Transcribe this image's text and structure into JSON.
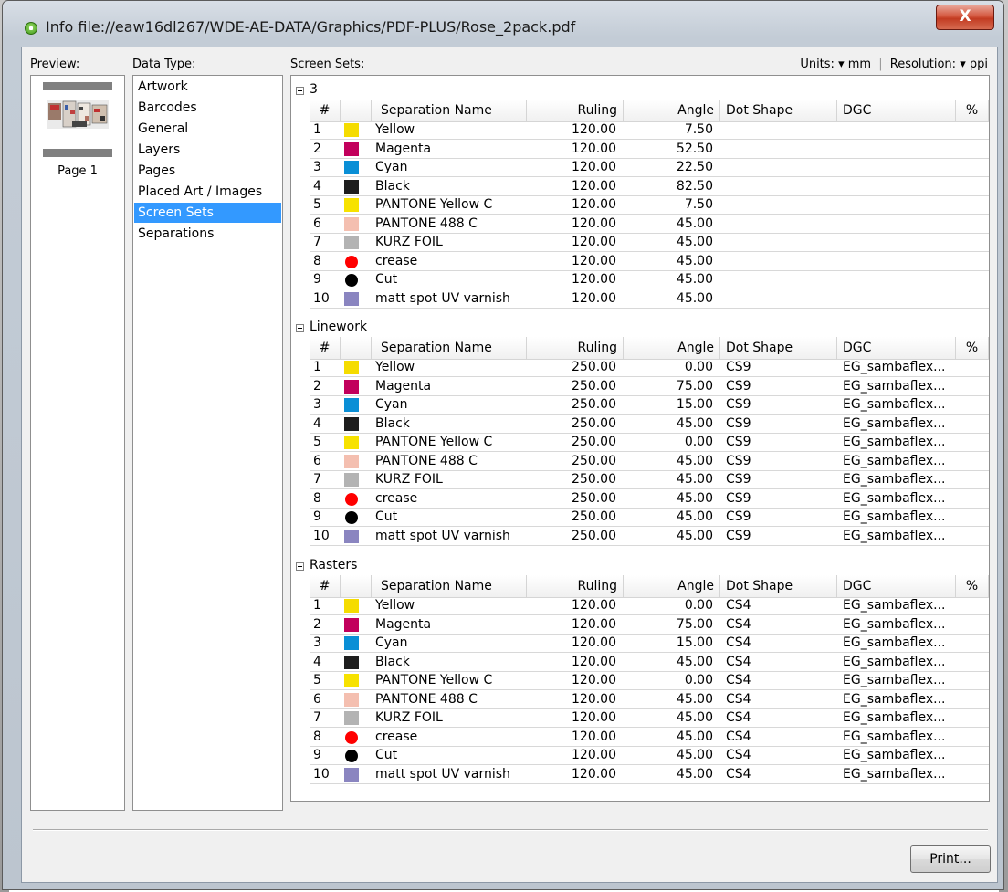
{
  "window": {
    "title": "Info file://eaw16dl267/WDE-AE-DATA/Graphics/PDF-PLUS/Rose_2pack.pdf",
    "close_label": "X"
  },
  "preview": {
    "label": "Preview:",
    "page_label": "Page 1"
  },
  "data_type": {
    "label": "Data Type:",
    "items": [
      "Artwork",
      "Barcodes",
      "General",
      "Layers",
      "Pages",
      "Placed Art / Images",
      "Screen Sets",
      "Separations"
    ],
    "selected": "Screen Sets"
  },
  "screen_sets": {
    "label": "Screen Sets:",
    "units_label": "Units:",
    "units_value": "mm",
    "resolution_label": "Resolution:",
    "resolution_value": "ppi",
    "columns": [
      "#",
      "",
      "Separation Name",
      "Ruling",
      "Angle",
      "Dot Shape",
      "DGC",
      "%"
    ],
    "groups": [
      {
        "name": "3",
        "rows": [
          {
            "num": "1",
            "color": "#f5dc00",
            "shape": "square",
            "name": "Yellow",
            "ruling": "120.00",
            "angle": "7.50",
            "dot": "",
            "dgc": ""
          },
          {
            "num": "2",
            "color": "#c2005c",
            "shape": "square",
            "name": "Magenta",
            "ruling": "120.00",
            "angle": "52.50",
            "dot": "",
            "dgc": ""
          },
          {
            "num": "3",
            "color": "#0a8fd6",
            "shape": "square",
            "name": "Cyan",
            "ruling": "120.00",
            "angle": "22.50",
            "dot": "",
            "dgc": ""
          },
          {
            "num": "4",
            "color": "#1e1e1e",
            "shape": "square",
            "name": "Black",
            "ruling": "120.00",
            "angle": "82.50",
            "dot": "",
            "dgc": ""
          },
          {
            "num": "5",
            "color": "#f7e200",
            "shape": "square",
            "name": "PANTONE Yellow C",
            "ruling": "120.00",
            "angle": "7.50",
            "dot": "",
            "dgc": ""
          },
          {
            "num": "6",
            "color": "#f4bfb0",
            "shape": "square",
            "name": "PANTONE 488 C",
            "ruling": "120.00",
            "angle": "45.00",
            "dot": "",
            "dgc": ""
          },
          {
            "num": "7",
            "color": "#b3b3b3",
            "shape": "square",
            "name": "KURZ FOIL",
            "ruling": "120.00",
            "angle": "45.00",
            "dot": "",
            "dgc": ""
          },
          {
            "num": "8",
            "color": "#ff0000",
            "shape": "round",
            "name": "crease",
            "ruling": "120.00",
            "angle": "45.00",
            "dot": "",
            "dgc": ""
          },
          {
            "num": "9",
            "color": "#000000",
            "shape": "round",
            "name": "Cut",
            "ruling": "120.00",
            "angle": "45.00",
            "dot": "",
            "dgc": ""
          },
          {
            "num": "10",
            "color": "#8a85c0",
            "shape": "square",
            "name": "matt spot UV varnish",
            "ruling": "120.00",
            "angle": "45.00",
            "dot": "",
            "dgc": ""
          }
        ]
      },
      {
        "name": "Linework",
        "rows": [
          {
            "num": "1",
            "color": "#f5dc00",
            "shape": "square",
            "name": "Yellow",
            "ruling": "250.00",
            "angle": "0.00",
            "dot": "CS9",
            "dgc": "EG_sambaflex..."
          },
          {
            "num": "2",
            "color": "#c2005c",
            "shape": "square",
            "name": "Magenta",
            "ruling": "250.00",
            "angle": "75.00",
            "dot": "CS9",
            "dgc": "EG_sambaflex..."
          },
          {
            "num": "3",
            "color": "#0a8fd6",
            "shape": "square",
            "name": "Cyan",
            "ruling": "250.00",
            "angle": "15.00",
            "dot": "CS9",
            "dgc": "EG_sambaflex..."
          },
          {
            "num": "4",
            "color": "#1e1e1e",
            "shape": "square",
            "name": "Black",
            "ruling": "250.00",
            "angle": "45.00",
            "dot": "CS9",
            "dgc": "EG_sambaflex..."
          },
          {
            "num": "5",
            "color": "#f7e200",
            "shape": "square",
            "name": "PANTONE Yellow C",
            "ruling": "250.00",
            "angle": "0.00",
            "dot": "CS9",
            "dgc": "EG_sambaflex..."
          },
          {
            "num": "6",
            "color": "#f4bfb0",
            "shape": "square",
            "name": "PANTONE 488 C",
            "ruling": "250.00",
            "angle": "45.00",
            "dot": "CS9",
            "dgc": "EG_sambaflex..."
          },
          {
            "num": "7",
            "color": "#b3b3b3",
            "shape": "square",
            "name": "KURZ FOIL",
            "ruling": "250.00",
            "angle": "45.00",
            "dot": "CS9",
            "dgc": "EG_sambaflex..."
          },
          {
            "num": "8",
            "color": "#ff0000",
            "shape": "round",
            "name": "crease",
            "ruling": "250.00",
            "angle": "45.00",
            "dot": "CS9",
            "dgc": "EG_sambaflex..."
          },
          {
            "num": "9",
            "color": "#000000",
            "shape": "round",
            "name": "Cut",
            "ruling": "250.00",
            "angle": "45.00",
            "dot": "CS9",
            "dgc": "EG_sambaflex..."
          },
          {
            "num": "10",
            "color": "#8a85c0",
            "shape": "square",
            "name": "matt spot UV varnish",
            "ruling": "250.00",
            "angle": "45.00",
            "dot": "CS9",
            "dgc": "EG_sambaflex..."
          }
        ]
      },
      {
        "name": "Rasters",
        "rows": [
          {
            "num": "1",
            "color": "#f5dc00",
            "shape": "square",
            "name": "Yellow",
            "ruling": "120.00",
            "angle": "0.00",
            "dot": "CS4",
            "dgc": "EG_sambaflex..."
          },
          {
            "num": "2",
            "color": "#c2005c",
            "shape": "square",
            "name": "Magenta",
            "ruling": "120.00",
            "angle": "75.00",
            "dot": "CS4",
            "dgc": "EG_sambaflex..."
          },
          {
            "num": "3",
            "color": "#0a8fd6",
            "shape": "square",
            "name": "Cyan",
            "ruling": "120.00",
            "angle": "15.00",
            "dot": "CS4",
            "dgc": "EG_sambaflex..."
          },
          {
            "num": "4",
            "color": "#1e1e1e",
            "shape": "square",
            "name": "Black",
            "ruling": "120.00",
            "angle": "45.00",
            "dot": "CS4",
            "dgc": "EG_sambaflex..."
          },
          {
            "num": "5",
            "color": "#f7e200",
            "shape": "square",
            "name": "PANTONE Yellow C",
            "ruling": "120.00",
            "angle": "0.00",
            "dot": "CS4",
            "dgc": "EG_sambaflex..."
          },
          {
            "num": "6",
            "color": "#f4bfb0",
            "shape": "square",
            "name": "PANTONE 488 C",
            "ruling": "120.00",
            "angle": "45.00",
            "dot": "CS4",
            "dgc": "EG_sambaflex..."
          },
          {
            "num": "7",
            "color": "#b3b3b3",
            "shape": "square",
            "name": "KURZ FOIL",
            "ruling": "120.00",
            "angle": "45.00",
            "dot": "CS4",
            "dgc": "EG_sambaflex..."
          },
          {
            "num": "8",
            "color": "#ff0000",
            "shape": "round",
            "name": "crease",
            "ruling": "120.00",
            "angle": "45.00",
            "dot": "CS4",
            "dgc": "EG_sambaflex..."
          },
          {
            "num": "9",
            "color": "#000000",
            "shape": "round",
            "name": "Cut",
            "ruling": "120.00",
            "angle": "45.00",
            "dot": "CS4",
            "dgc": "EG_sambaflex..."
          },
          {
            "num": "10",
            "color": "#8a85c0",
            "shape": "square",
            "name": "matt spot UV varnish",
            "ruling": "120.00",
            "angle": "45.00",
            "dot": "CS4",
            "dgc": "EG_sambaflex..."
          }
        ]
      }
    ]
  },
  "footer": {
    "print_label": "Print..."
  }
}
